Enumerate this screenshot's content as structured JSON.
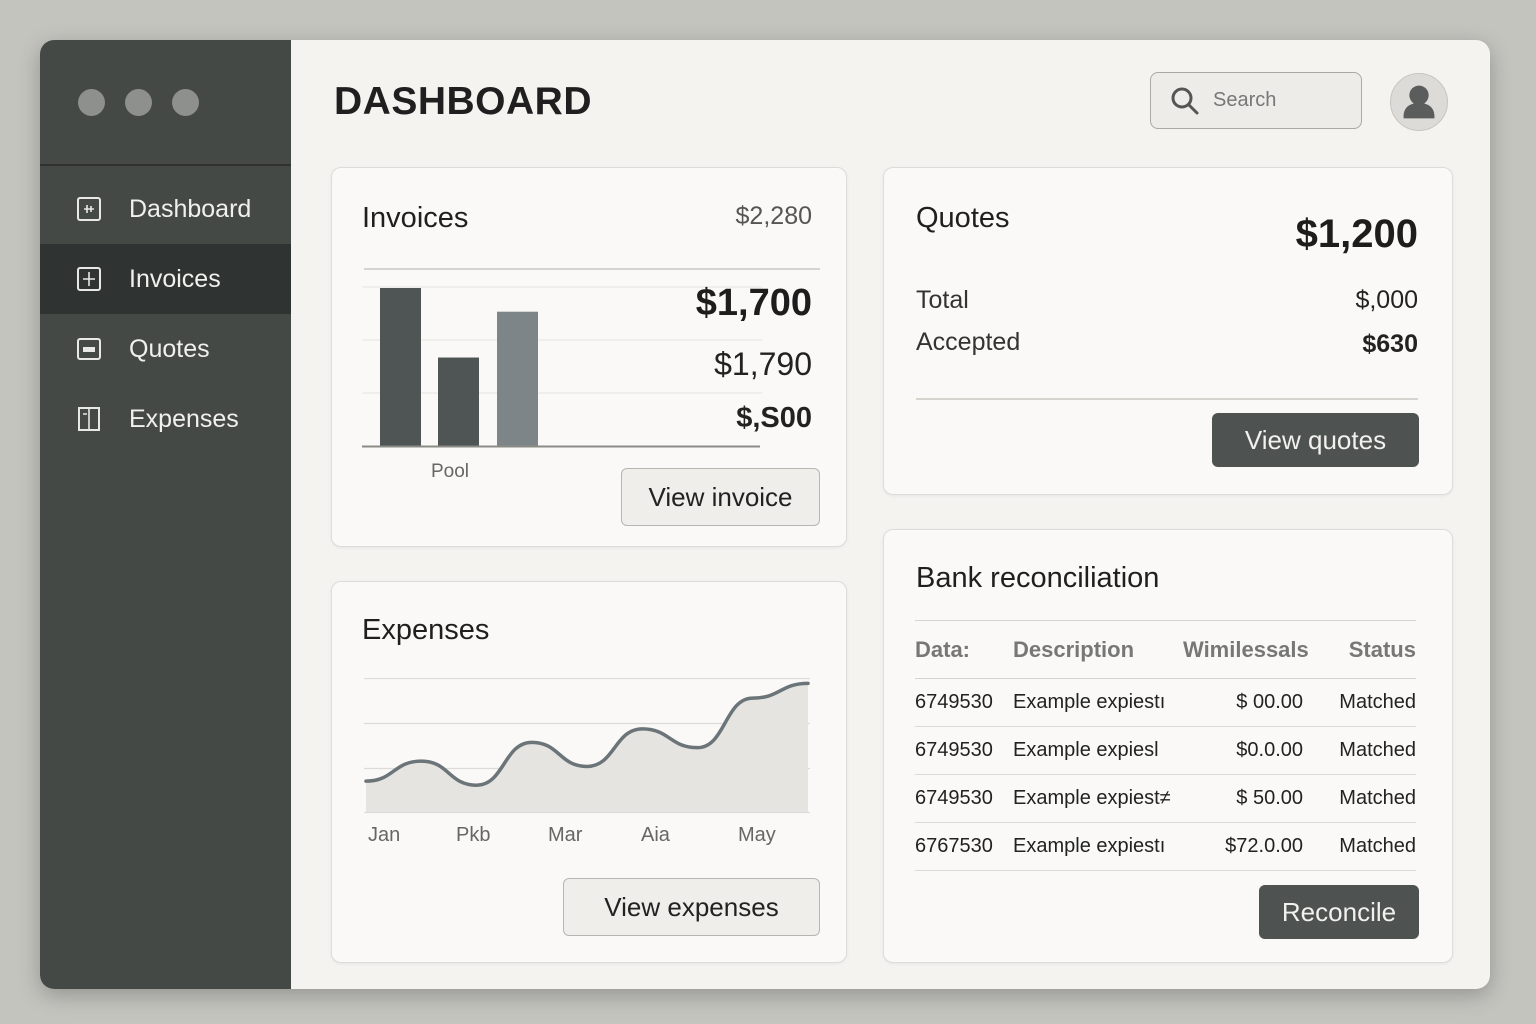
{
  "window": {
    "dots": [
      "close",
      "minimize",
      "maximize"
    ]
  },
  "sidebar": {
    "items": [
      {
        "label": "Dashboard",
        "icon": "dashboard-icon",
        "active": false
      },
      {
        "label": "Invoices",
        "icon": "invoice-icon",
        "active": true
      },
      {
        "label": "Quotes",
        "icon": "quote-icon",
        "active": false
      },
      {
        "label": "Expenses",
        "icon": "expenses-icon",
        "active": false
      }
    ]
  },
  "header": {
    "title": "DASHBOARD",
    "search_placeholder": "Search",
    "search_icon": "search-icon",
    "avatar_icon": "user-icon"
  },
  "invoices": {
    "title": "Invoices",
    "total": "$2,280",
    "amount_1": "$1,700",
    "amount_2": "$1,790",
    "amount_3": "$,S00",
    "bar_label": "Pool",
    "button": "View invoice"
  },
  "quotes": {
    "title": "Quotes",
    "big_amount": "$1,200",
    "rows": [
      {
        "label": "Total",
        "value": "$,000"
      },
      {
        "label": "Accepted",
        "value": "$630"
      }
    ],
    "button": "View quotes"
  },
  "expenses": {
    "title": "Expenses",
    "button": "View expenses"
  },
  "bank": {
    "title": "Bank reconciliation",
    "columns": [
      "Data:",
      "Description",
      "Wimilessals",
      "Status"
    ],
    "rows": [
      {
        "data": "6749530",
        "description": "Example expiestı",
        "amount": "$ 00.00",
        "status": "Matched"
      },
      {
        "data": "6749530",
        "description": "Example expiesl",
        "amount": "$0.0.00",
        "status": "Matched"
      },
      {
        "data": "6749530",
        "description": "Example expiest≠",
        "amount": "$  50.00",
        "status": "Matched"
      },
      {
        "data": "6767530",
        "description": "Example expiestı",
        "amount": "$72.0.00",
        "status": "Matched"
      }
    ],
    "button": "Reconcile"
  },
  "colors": {
    "sidebar": "#454946",
    "sidebar_active": "#2f3331",
    "bar_dark": "#4f5554",
    "bar_light": "#7d8588",
    "line": "#6b7478",
    "button_dark": "#4e5250"
  },
  "chart_data": [
    {
      "type": "bar",
      "categories": [
        "",
        "",
        ""
      ],
      "values": [
        100,
        56,
        85
      ],
      "xlabel": "Pool",
      "ylim": [
        0,
        100
      ]
    },
    {
      "type": "area",
      "x": [
        "Jan",
        "Pkb",
        "Mar",
        "Aia",
        "May"
      ],
      "values": [
        23,
        38,
        20,
        52,
        34,
        62,
        48,
        85,
        96
      ],
      "grid": true,
      "ylim": [
        0,
        100
      ]
    }
  ]
}
